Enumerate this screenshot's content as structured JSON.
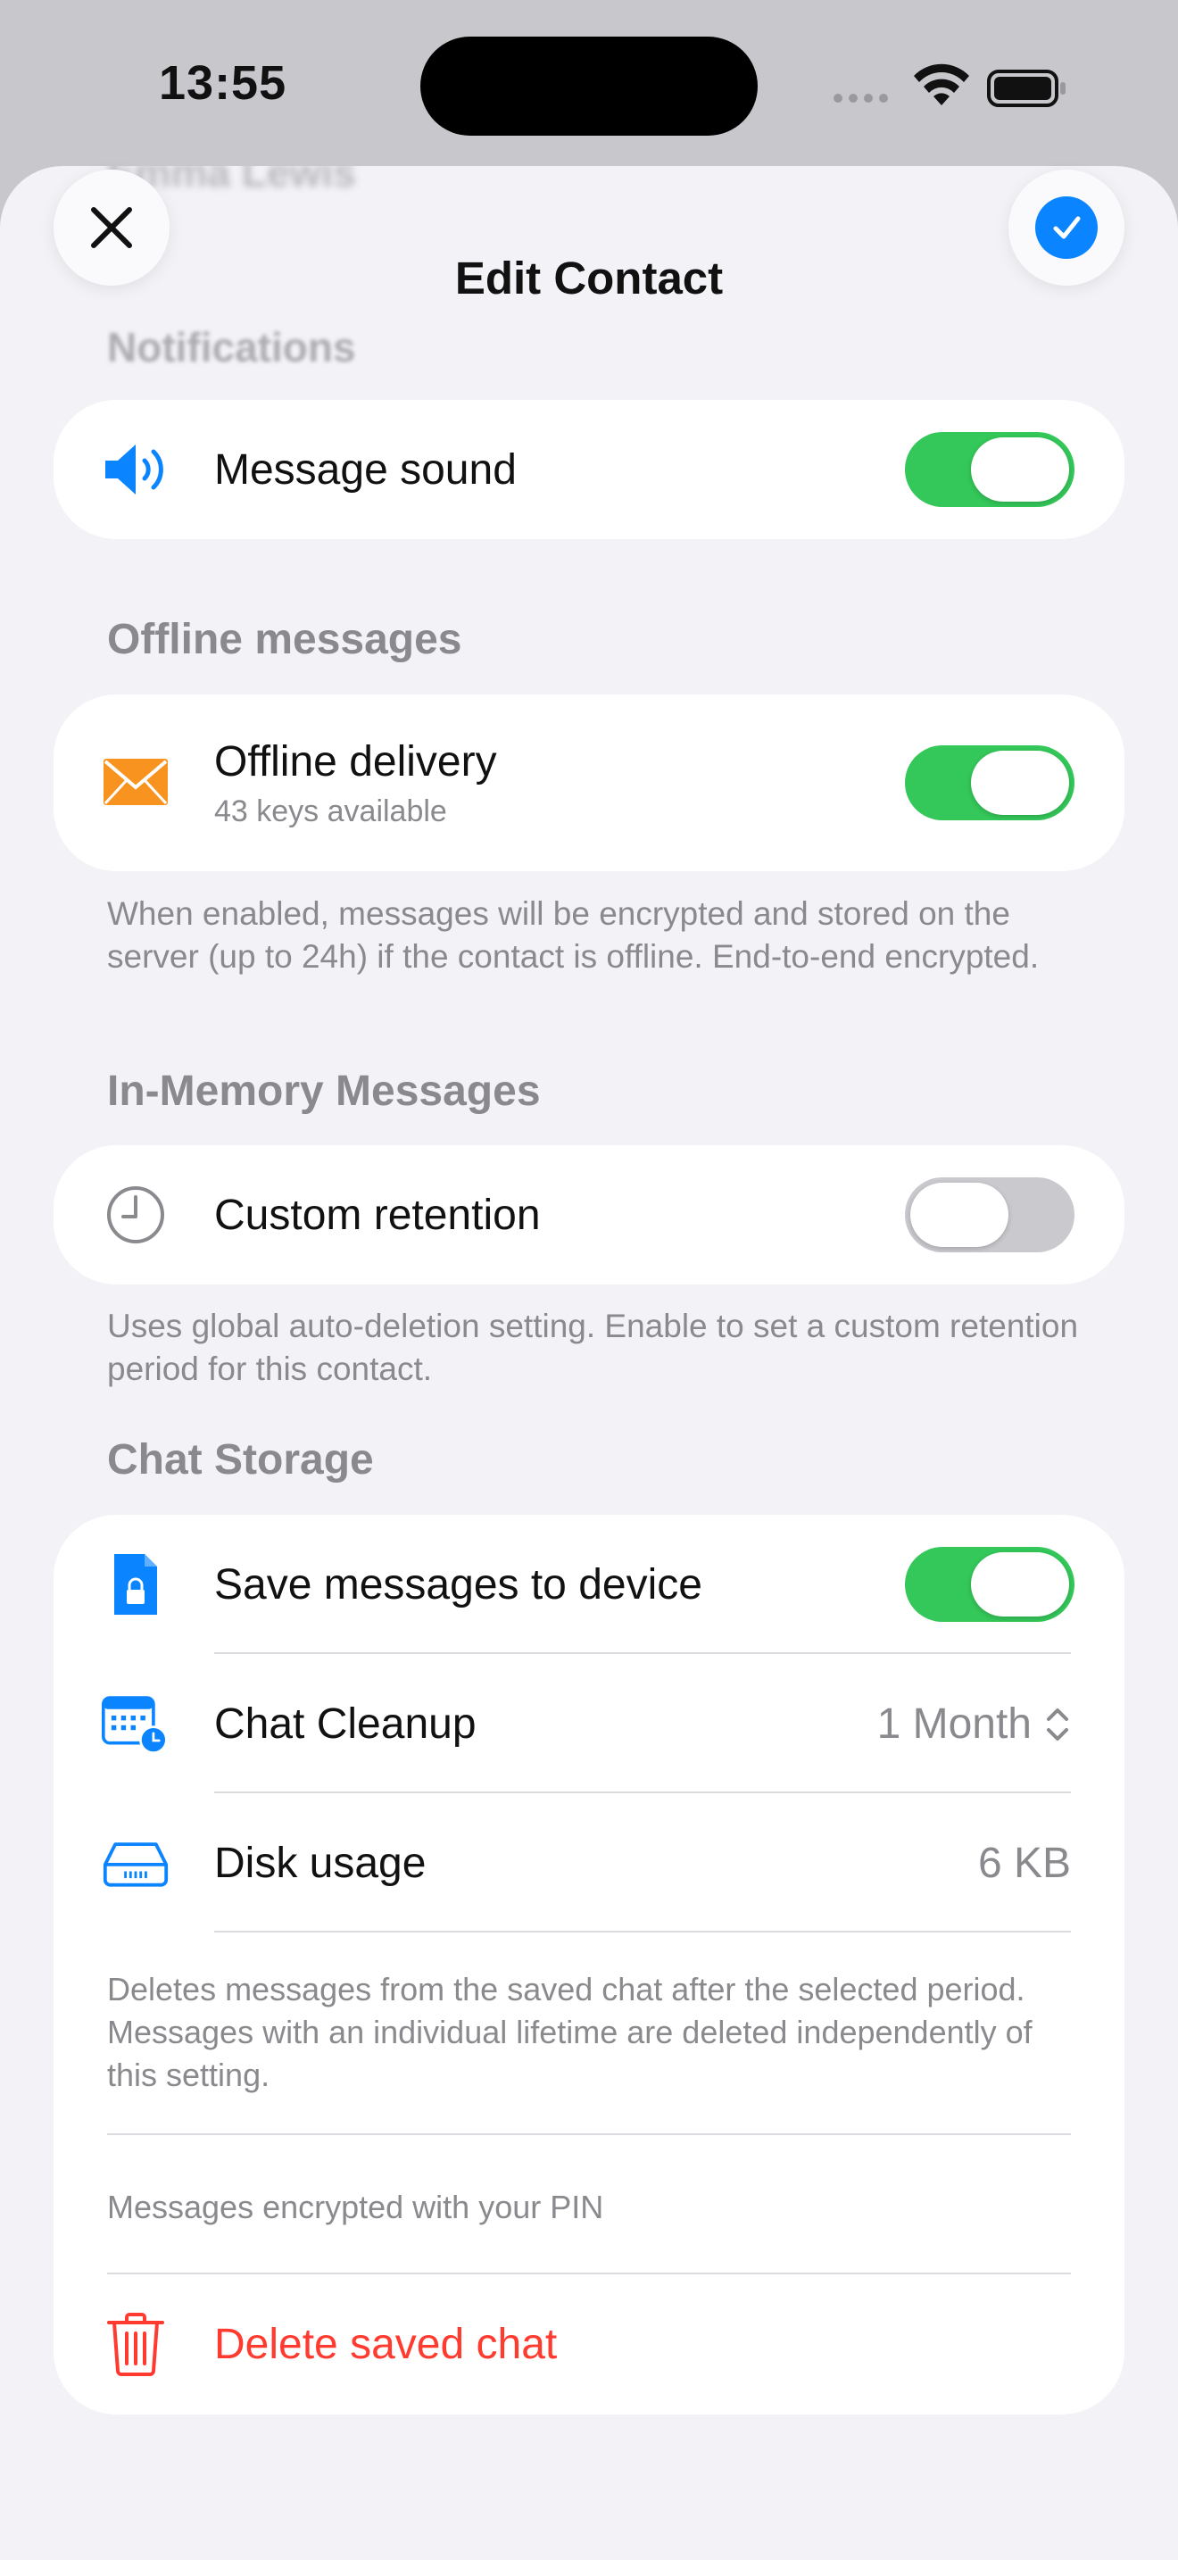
{
  "status_bar": {
    "time": "13:55",
    "icons": [
      "cellular-dots-icon",
      "wifi-icon",
      "battery-icon"
    ]
  },
  "background": {
    "ghost_title": "Emma Lewis",
    "ghost_section": "Notifications"
  },
  "header": {
    "title": "Edit Contact",
    "close_icon": "close-icon",
    "done_icon": "checkmark-icon"
  },
  "notifications": {
    "message_sound": {
      "label": "Message sound",
      "enabled": true,
      "icon": "speaker-icon"
    }
  },
  "offline": {
    "section": "Offline messages",
    "delivery": {
      "label": "Offline delivery",
      "sub": "43 keys available",
      "enabled": true,
      "icon": "envelope-icon"
    },
    "footnote": "When enabled, messages will be encrypted and stored on the server (up to 24h) if the contact is offline. End-to-end encrypted."
  },
  "in_memory": {
    "section": "In-Memory Messages",
    "retention": {
      "label": "Custom retention",
      "enabled": false,
      "icon": "clock-icon"
    },
    "footnote": "Uses global auto-deletion setting. Enable to set a custom retention period for this contact."
  },
  "storage": {
    "section": "Chat Storage",
    "save": {
      "label": "Save messages to device",
      "enabled": true,
      "icon": "locked-document-icon"
    },
    "cleanup": {
      "label": "Chat Cleanup",
      "value": "1 Month",
      "icon": "calendar-clock-icon"
    },
    "disk": {
      "label": "Disk usage",
      "value": "6 KB",
      "icon": "disk-drive-icon"
    },
    "cleanup_note": "Deletes messages from the saved chat after the selected period. Messages with an individual lifetime are deleted independently of this setting.",
    "pin_note": "Messages encrypted with your PIN",
    "delete": {
      "label": "Delete saved chat",
      "icon": "trash-icon"
    }
  },
  "colors": {
    "accent": "#0a84ff",
    "toggle_on": "#34c759",
    "toggle_off": "#c9c9ce",
    "danger": "#ff3b30",
    "envelope": "#f7931e"
  }
}
